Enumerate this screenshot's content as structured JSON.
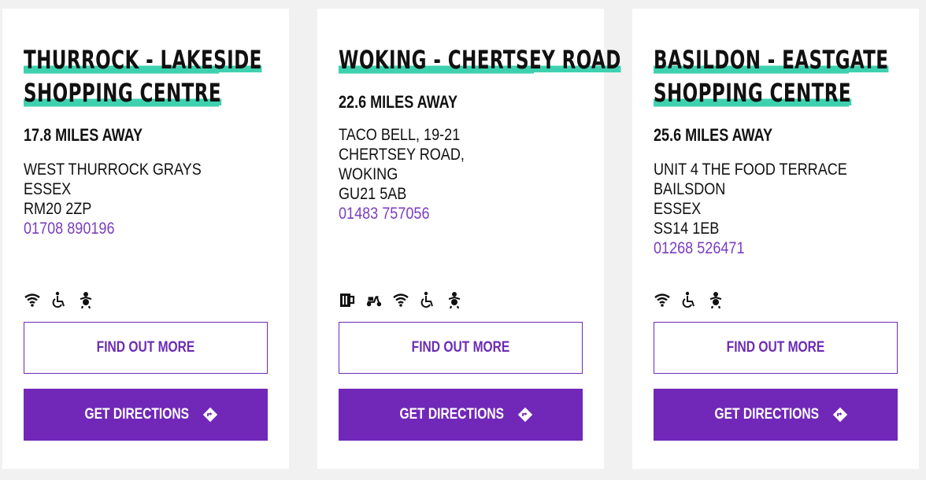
{
  "stores": [
    {
      "title_lines": [
        "THURROCK - LAKESIDE",
        "SHOPPING CENTRE"
      ],
      "distance": "17.8 MILES AWAY",
      "address_lines": [
        "WEST THURROCK GRAYS",
        "ESSEX",
        "RM20 2ZP"
      ],
      "phone": "01708 890196",
      "amenities": [
        "wifi-icon",
        "wheelchair-access-icon",
        "baby-changing-icon"
      ],
      "find_out_more_label": "FIND OUT MORE",
      "directions_label": "GET DIRECTIONS"
    },
    {
      "title_lines": [
        "WOKING - CHERTSEY ROAD"
      ],
      "distance": "22.6 MILES AWAY",
      "address_lines": [
        "TACO BELL, 19-21",
        "CHERTSEY ROAD,",
        "WOKING",
        "GU21 5AB"
      ],
      "phone": "01483 757056",
      "amenities": [
        "beer-icon",
        "delivery-scooter-icon",
        "wifi-icon",
        "wheelchair-access-icon",
        "baby-changing-icon"
      ],
      "find_out_more_label": "FIND OUT MORE",
      "directions_label": "GET DIRECTIONS"
    },
    {
      "title_lines": [
        "BASILDON - EASTGATE",
        "SHOPPING CENTRE"
      ],
      "distance": "25.6 MILES AWAY",
      "address_lines": [
        "UNIT 4 THE FOOD TERRACE",
        "BAILSDON",
        "ESSEX",
        "SS14 1EB"
      ],
      "phone": "01268 526471",
      "amenities": [
        "wifi-icon",
        "wheelchair-access-icon",
        "baby-changing-icon"
      ],
      "find_out_more_label": "FIND OUT MORE",
      "directions_label": "GET DIRECTIONS"
    }
  ],
  "colors": {
    "accent_purple": "#7128b8",
    "highlight_teal": "#3ed1b0",
    "phone_purple": "#7a3ec0"
  }
}
